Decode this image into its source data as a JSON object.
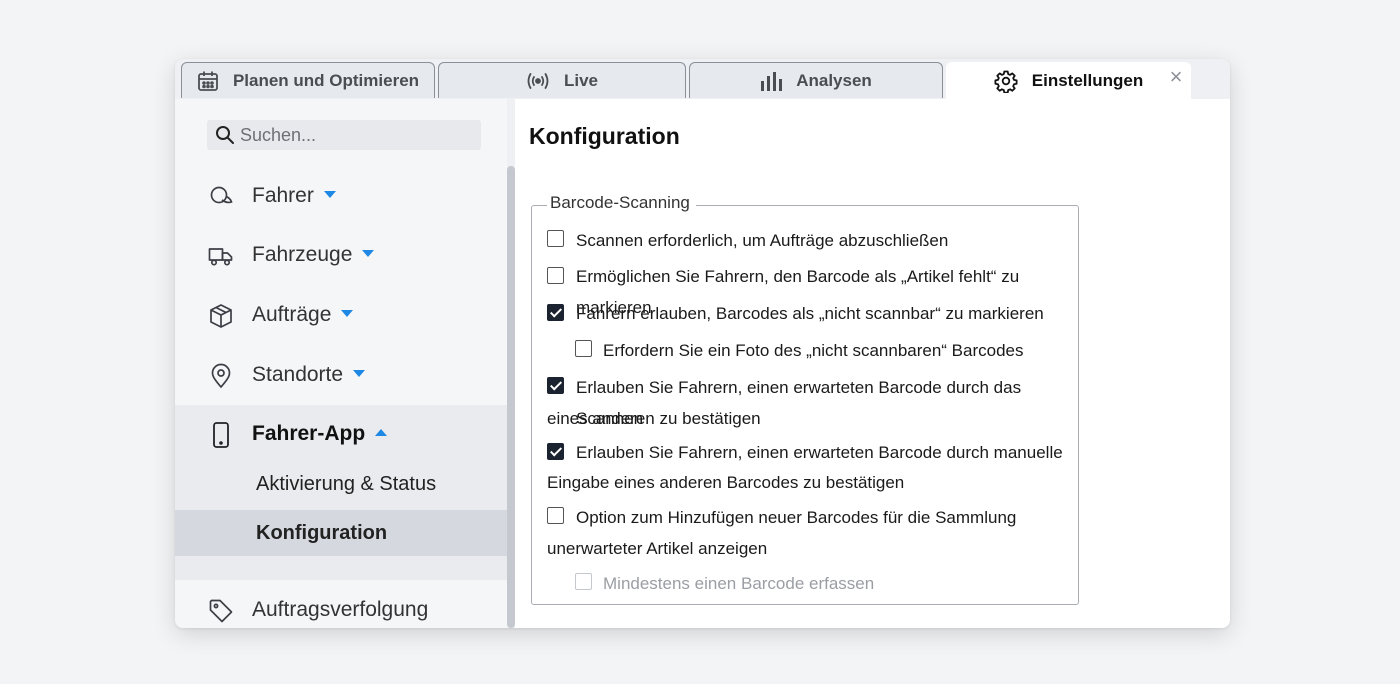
{
  "tabs": [
    {
      "label": "Planen und Optimieren",
      "icon": "calendar-icon"
    },
    {
      "label": "Live",
      "icon": "broadcast-icon"
    },
    {
      "label": "Analysen",
      "icon": "bar-chart-icon"
    },
    {
      "label": "Einstellungen",
      "icon": "gear-icon",
      "active": true
    }
  ],
  "close_symbol": "×",
  "search": {
    "placeholder": "Suchen..."
  },
  "sidebar": {
    "items": [
      {
        "label": "Fahrer",
        "icon": "person-icon"
      },
      {
        "label": "Fahrzeuge",
        "icon": "truck-icon"
      },
      {
        "label": "Aufträge",
        "icon": "box-icon"
      },
      {
        "label": "Standorte",
        "icon": "map-pin-icon"
      },
      {
        "label": "Fahrer-App",
        "icon": "smartphone-icon",
        "expanded": true
      },
      {
        "label": "Auftragsverfolgung",
        "icon": "tag-icon"
      }
    ],
    "subitems": [
      {
        "label": "Aktivierung & Status"
      },
      {
        "label": "Konfiguration",
        "active": true
      }
    ]
  },
  "main": {
    "title": "Konfiguration",
    "group_label": "Barcode-Scanning",
    "options": [
      {
        "label": "Scannen erforderlich, um Aufträge abzuschließen",
        "checked": false
      },
      {
        "label": "Ermöglichen Sie Fahrern, den Barcode als „Artikel fehlt“ zu markieren",
        "checked": false
      },
      {
        "label": "Fahrern erlauben, Barcodes als „nicht scannbar“ zu markieren",
        "checked": true
      },
      {
        "label": "Erfordern Sie ein Foto des „nicht scannbaren“ Barcodes",
        "checked": false
      },
      {
        "label_line1": "Erlauben Sie Fahrern, einen erwarteten Barcode durch das Scannen",
        "label_line2": "eines anderen zu bestätigen",
        "checked": true
      },
      {
        "label_line1": "Erlauben Sie Fahrern, einen erwarteten Barcode durch manuelle",
        "label_line2": "Eingabe eines anderen Barcodes zu bestätigen",
        "checked": true
      },
      {
        "label_line1": "Option zum Hinzufügen neuer Barcodes für die Sammlung",
        "label_line2": "unerwarteter Artikel anzeigen",
        "checked": false
      },
      {
        "label": "Mindestens einen Barcode erfassen",
        "checked": false,
        "disabled": true
      }
    ]
  },
  "colors": {
    "accent": "#1e88e5",
    "checked": "#1b2230"
  }
}
